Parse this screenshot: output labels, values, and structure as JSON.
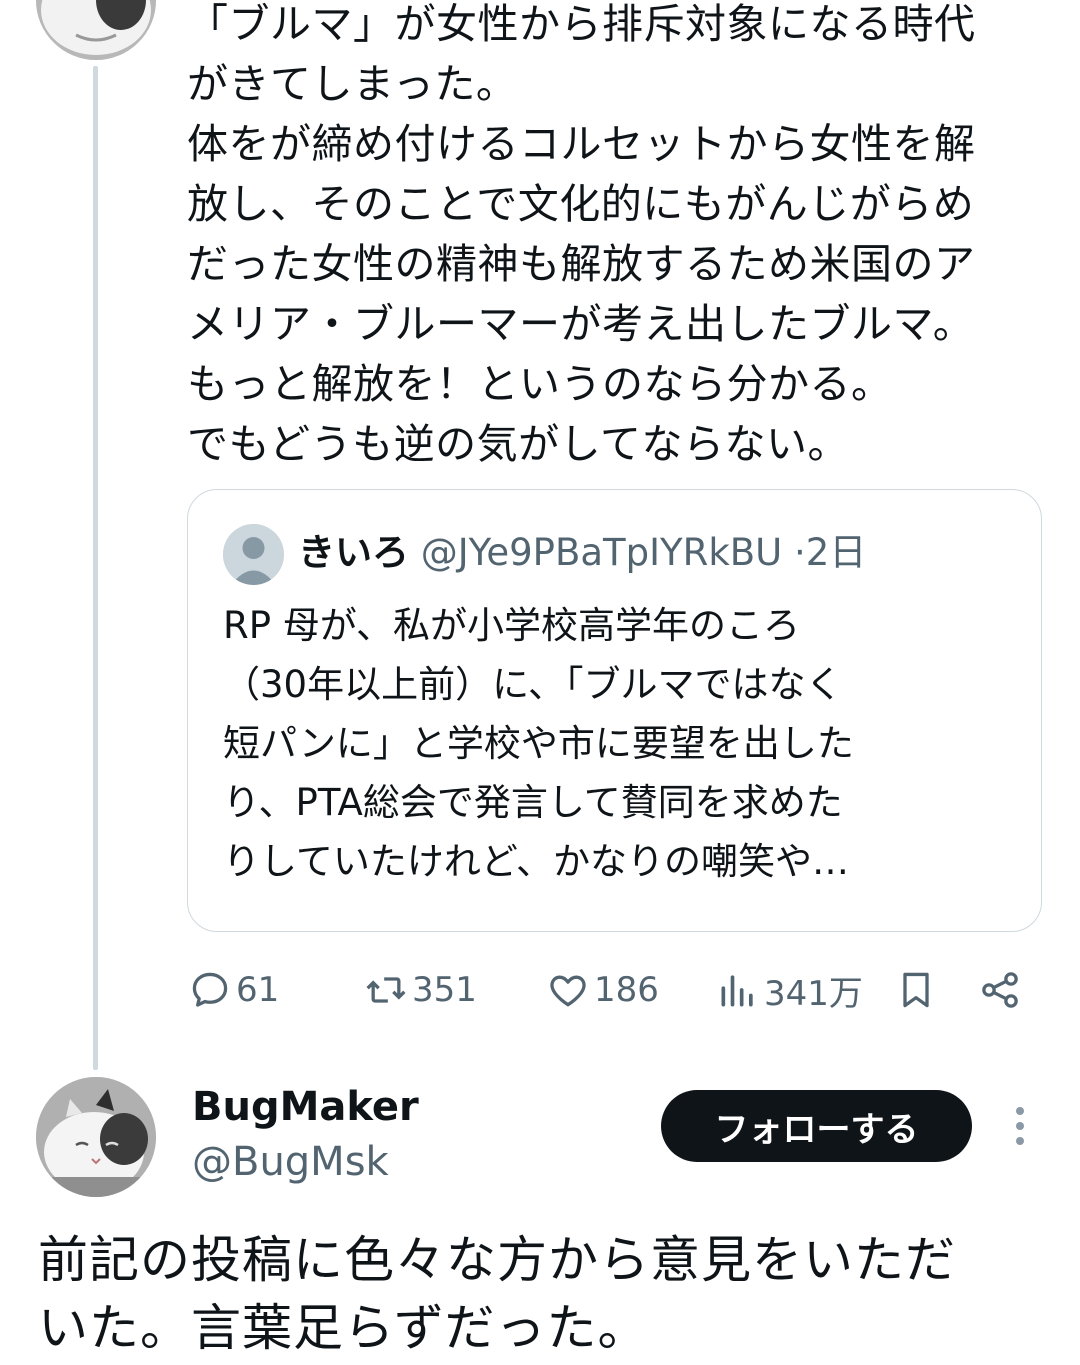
{
  "post1": {
    "text": "「ブルマ」が女性から排斥対象になる時代\nがきてしまった。\n体をが締め付けるコルセットから女性を解\n放し、そのことで文化的にもがんじがらめ\nだった女性の精神も解放するため米国のア\nメリア・ブルーマーが考え出したブルマ。\nもっと解放を！というのなら分かる。\nでもどうも逆の気がしてならない。",
    "quote": {
      "name": "きいろ",
      "handle": "@JYe9PBaTpIYRkBU",
      "dot": "·",
      "time": "2日",
      "text": "RP 母が、私が小学校高学年のころ\n（30年以上前）に、「ブルマではなく\n短パンに」と学校や市に要望を出した\nり、PTA総会で発言して賛同を求めた\nりしていたけれど、かなりの嘲笑や…"
    },
    "actions": {
      "replies": "61",
      "reposts": "351",
      "likes": "186",
      "views": "341万"
    }
  },
  "post2": {
    "author_name": "BugMaker",
    "author_handle": "@BugMsk",
    "follow_label": "フォローする",
    "text": "前記の投稿に色々な方から意見をいただ\nいた。言葉足らずだった。"
  },
  "icons": {
    "reply": "speech-bubble-icon",
    "repost": "repost-arrows-icon",
    "like": "heart-icon",
    "views": "bar-chart-icon",
    "bookmark": "bookmark-icon",
    "share": "share-icon",
    "more": "vertical-dots-icon"
  },
  "colors": {
    "text": "#0f1419",
    "secondary": "#536471",
    "border": "#cfd9de",
    "button": "#0f1419"
  }
}
